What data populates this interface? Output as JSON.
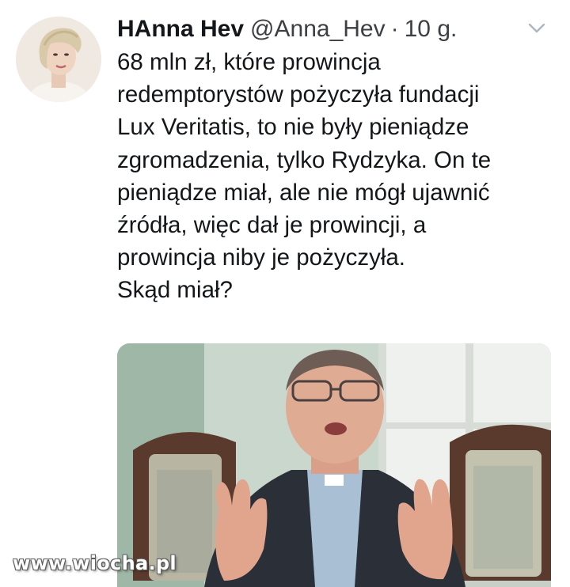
{
  "tweet": {
    "author_name": "HAnna Hev",
    "handle": "@Anna_Hev",
    "separator": "·",
    "time": "10 g.",
    "text_lines": [
      "68 mln zł, które prowincja",
      "redemptorystów pożyczyła fundacji",
      "Lux Veritatis, to nie były pieniądze",
      "zgromadzenia, tylko Rydzyka. On te",
      "pieniądze miał, ale nie mógł ujawnić",
      "źródła, więc dał je prowincji, a",
      "prowincja niby je pożyczyła.",
      "Skąd miał?"
    ],
    "menu_icon": "chevron-down-icon",
    "avatar_icon": "avatar"
  },
  "watermark": {
    "text": "www.wiocha.pl"
  },
  "colors": {
    "text": "#14171a",
    "secondary": "#3c4043",
    "chevron": "#aab8c2",
    "background": "#ffffff"
  }
}
